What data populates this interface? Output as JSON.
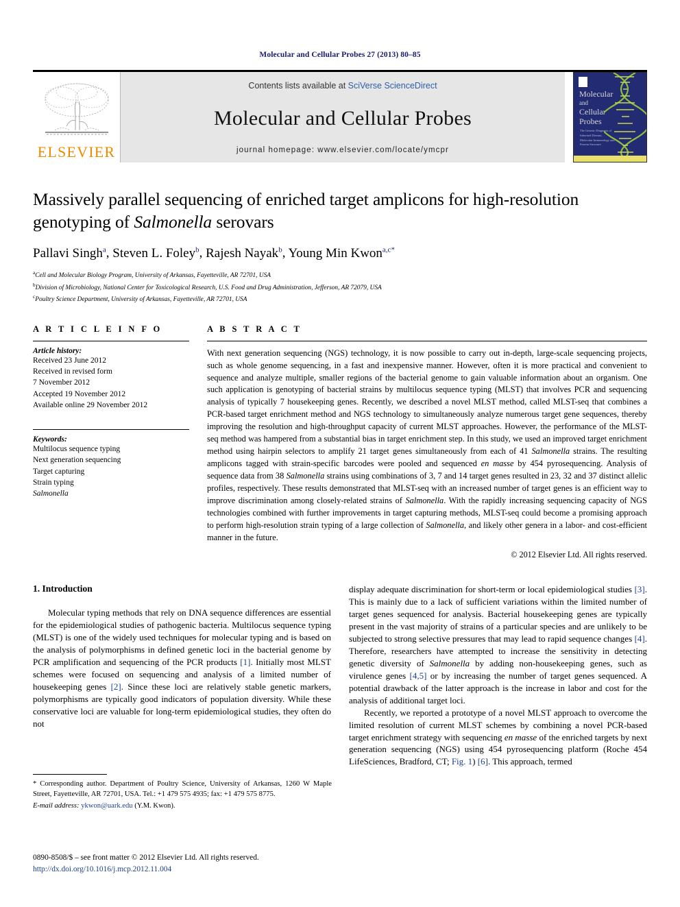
{
  "running_head": "Molecular and Cellular Probes 27 (2013) 80–85",
  "masthead": {
    "publisher_name": "ELSEVIER",
    "contents_prefix": "Contents lists available at ",
    "contents_link": "SciVerse ScienceDirect",
    "journal_title": "Molecular and Cellular Probes",
    "homepage_label": "journal homepage: www.elsevier.com/locate/ymcpr",
    "cover": {
      "line1": "Molecular",
      "line2": "and",
      "line3": "Cellular",
      "line4": "Probes",
      "subtext": "The Genetic Diagnosis of Inherited Disease, Molecular Immunology and Protein Structure"
    }
  },
  "article": {
    "title_part1": "Massively parallel sequencing of enriched target amplicons for high-resolution genotyping of ",
    "title_italic": "Salmonella",
    "title_part2": " serovars",
    "authors_html": "Pallavi Singh, Steven L. Foley, Rajesh Nayak, Young Min Kwon",
    "author_list": [
      {
        "name": "Pallavi Singh",
        "sup": "a"
      },
      {
        "name": "Steven L. Foley",
        "sup": "b"
      },
      {
        "name": "Rajesh Nayak",
        "sup": "b"
      },
      {
        "name": "Young Min Kwon",
        "sup": "a,c",
        "corresponding": "*"
      }
    ],
    "affiliations": [
      {
        "marker": "a",
        "text": "Cell and Molecular Biology Program, University of Arkansas, Fayetteville, AR 72701, USA"
      },
      {
        "marker": "b",
        "text": "Division of Microbiology, National Center for Toxicological Research, U.S. Food and Drug Administration, Jefferson, AR 72079, USA"
      },
      {
        "marker": "c",
        "text": "Poultry Science Department, University of Arkansas, Fayetteville, AR 72701, USA"
      }
    ]
  },
  "article_info": {
    "heading": "A R T I C L E   I N F O",
    "history_label": "Article history:",
    "history": [
      "Received 23 June 2012",
      "Received in revised form",
      "7 November 2012",
      "Accepted 19 November 2012",
      "Available online 29 November 2012"
    ],
    "keywords_label": "Keywords:",
    "keywords": [
      "Multilocus sequence typing",
      "Next generation sequencing",
      "Target capturing",
      "Strain typing"
    ],
    "keyword_italic": "Salmonella"
  },
  "abstract": {
    "heading": "A B S T R A C T",
    "p1": "With next generation sequencing (NGS) technology, it is now possible to carry out in-depth, large-scale sequencing projects, such as whole genome sequencing, in a fast and inexpensive manner. However, often it is more practical and convenient to sequence and analyze multiple, smaller regions of the bacterial genome to gain valuable information about an organism. One such application is genotyping of bacterial strains by multilocus sequence typing (MLST) that involves PCR and sequencing analysis of typically 7 housekeeping genes. Recently, we described a novel MLST method, called MLST-seq that combines a PCR-based target enrichment method and NGS technology to simultaneously analyze numerous target gene sequences, thereby improving the resolution and high-throughput capacity of current MLST approaches. However, the performance of the MLST-seq method was hampered from a substantial bias in target enrichment step. In this study, we used an improved target enrichment method using hairpin selectors to amplify 21 target genes simultaneously from each of 41 ",
    "i1": "Salmonella",
    "p2": " strains. The resulting amplicons tagged with strain-specific barcodes were pooled and sequenced ",
    "i2": "en masse",
    "p3": " by 454 pyrosequencing. Analysis of sequence data from 38 ",
    "i3": "Salmonella",
    "p4": " strains using combinations of 3, 7 and 14 target genes resulted in 23, 32 and 37 distinct allelic profiles, respectively. These results demonstrated that MLST-seq with an increased number of target genes is an efficient way to improve discrimination among closely-related strains of ",
    "i4": "Salmonella",
    "p5": ". With the rapidly increasing sequencing capacity of NGS technologies combined with further improvements in target capturing methods, MLST-seq could become a promising approach to perform high-resolution strain typing of a large collection of ",
    "i5": "Salmonella",
    "p6": ", and likely other genera in a labor- and cost-efficient manner in the future.",
    "copyright": "© 2012 Elsevier Ltd. All rights reserved."
  },
  "introduction": {
    "heading": "1. Introduction",
    "left_p1_a": "Molecular typing methods that rely on DNA sequence differences are essential for the epidemiological studies of pathogenic bacteria. Multilocus sequence typing (MLST) is one of the widely used techniques for molecular typing and is based on the analysis of polymorphisms in defined genetic loci in the bacterial genome by PCR amplification and sequencing of the PCR products ",
    "ref1": "[1]",
    "left_p1_b": ". Initially most MLST schemes were focused on sequencing and analysis of a limited number of housekeeping genes ",
    "ref2": "[2]",
    "left_p1_c": ". Since these loci are relatively stable genetic markers, polymorphisms are typically good indicators of population diversity. While these conservative loci are valuable for long-term epidemiological studies, they often do not",
    "right_p1_a": "display adequate discrimination for short-term or local epidemiological studies ",
    "ref3": "[3]",
    "right_p1_b": ". This is mainly due to a lack of sufficient variations within the limited number of target genes sequenced for analysis. Bacterial housekeeping genes are typically present in the vast majority of strains of a particular species and are unlikely to be subjected to strong selective pressures that may lead to rapid sequence changes ",
    "ref4": "[4]",
    "right_p1_c": ". Therefore, researchers have attempted to increase the sensitivity in detecting genetic diversity of ",
    "right_italic1": "Salmonella",
    "right_p1_d": " by adding non-housekeeping genes, such as virulence genes ",
    "ref45": "[4,5]",
    "right_p1_e": " or by increasing the number of target genes sequenced. A potential drawback of the latter approach is the increase in labor and cost for the analysis of additional target loci.",
    "right_p2_a": "Recently, we reported a prototype of a novel MLST approach to overcome the limited resolution of current MLST schemes by combining a novel PCR-based target enrichment strategy with sequencing ",
    "right_italic2": "en masse",
    "right_p2_b": " of the enriched targets by next generation sequencing (NGS) using 454 pyrosequencing platform (Roche 454 LifeSciences, Bradford, CT; ",
    "fig_link": "Fig. 1",
    "right_p2_c": ") ",
    "ref6": "[6]",
    "right_p2_d": ". This approach, termed"
  },
  "footnote": {
    "star": "*",
    "corresponding_text": " Corresponding author. Department of Poultry Science, University of Arkansas, 1260 W Maple Street, Fayetteville, AR 72701, USA. Tel.: +1 479 575 4935; fax: +1 479 575 8775.",
    "email_label": "E-mail address:",
    "email": "ykwon@uark.edu",
    "email_suffix": " (Y.M. Kwon)."
  },
  "issn_block": {
    "line1": "0890-8508/$ – see front matter © 2012 Elsevier Ltd. All rights reserved.",
    "doi": "http://dx.doi.org/10.1016/j.mcp.2012.11.004"
  },
  "colors": {
    "journal_navy": "#1a1a6e",
    "elsevier_orange": "#ED8B00",
    "link_blue": "#1a3f8f",
    "band_gray": "#e6e6e6",
    "cover_navy": "#232c72",
    "cover_footer": "#e8e06a"
  }
}
